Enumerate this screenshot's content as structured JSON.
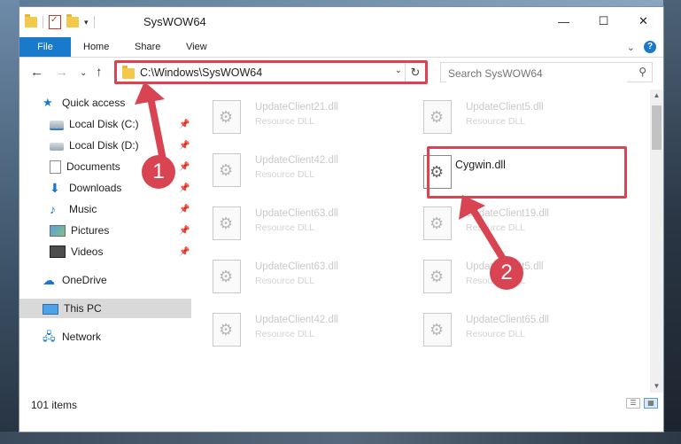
{
  "window": {
    "title": "SysWOW64",
    "buttons": {
      "minimize": "—",
      "maximize": "☐",
      "close": "✕"
    }
  },
  "quick_access_toolbar": {
    "menu": "▾"
  },
  "ribbon": {
    "tabs": [
      "File",
      "Home",
      "Share",
      "View"
    ],
    "expand": "⌄",
    "help": "?"
  },
  "navigation": {
    "back": "←",
    "forward": "→",
    "recent": "⌄",
    "up": "↑",
    "address": "C:\\Windows\\SysWOW64",
    "address_dropdown": "⌄",
    "refresh": "↻",
    "search_placeholder": "Search SysWOW64",
    "search_icon": "⚲"
  },
  "sidebar": {
    "pin_icon": "📌",
    "items": [
      {
        "label": "Quick access",
        "icon": "star-icon"
      },
      {
        "label": "Local Disk (C:)",
        "icon": "drive-icon",
        "pinned": true
      },
      {
        "label": "Local Disk (D:)",
        "icon": "drive-icon",
        "pinned": true
      },
      {
        "label": "Documents",
        "icon": "documents-icon",
        "pinned": true
      },
      {
        "label": "Downloads",
        "icon": "downloads-icon",
        "pinned": true
      },
      {
        "label": "Music",
        "icon": "music-icon",
        "pinned": true
      },
      {
        "label": "Pictures",
        "icon": "pictures-icon",
        "pinned": true
      },
      {
        "label": "Videos",
        "icon": "videos-icon",
        "pinned": true
      },
      {
        "label": "OneDrive",
        "icon": "cloud-icon"
      },
      {
        "label": "This PC",
        "icon": "computer-icon",
        "selected": true
      },
      {
        "label": "Network",
        "icon": "network-icon"
      }
    ]
  },
  "files": [
    {
      "name": "UpdateClient21.dll",
      "type": "Resource DLL"
    },
    {
      "name": "UpdateClient5.dll",
      "type": "Resource DLL"
    },
    {
      "name": "UpdateClient42.dll",
      "type": "Resource DLL"
    },
    {
      "name": "Cygwin.dll",
      "type": ""
    },
    {
      "name": "UpdateClient63.dll",
      "type": "Resource DLL"
    },
    {
      "name": "UpdateClient19.dll",
      "type": "Resource DLL"
    },
    {
      "name": "UpdateClient63.dll",
      "type": "Resource DLL"
    },
    {
      "name": "UpdateClient5.dll",
      "type": "Resource DLL"
    },
    {
      "name": "UpdateClient42.dll",
      "type": "Resource DLL"
    },
    {
      "name": "UpdateClient65.dll",
      "type": "Resource DLL"
    }
  ],
  "status": {
    "items_count": "101 items"
  },
  "scrollbar": {
    "up": "▲",
    "down": "▼"
  },
  "annotations": {
    "step1": "1",
    "step2": "2",
    "highlight_color": "#d94452"
  },
  "colors": {
    "accent": "#1979ca",
    "annotation": "#d94452"
  }
}
